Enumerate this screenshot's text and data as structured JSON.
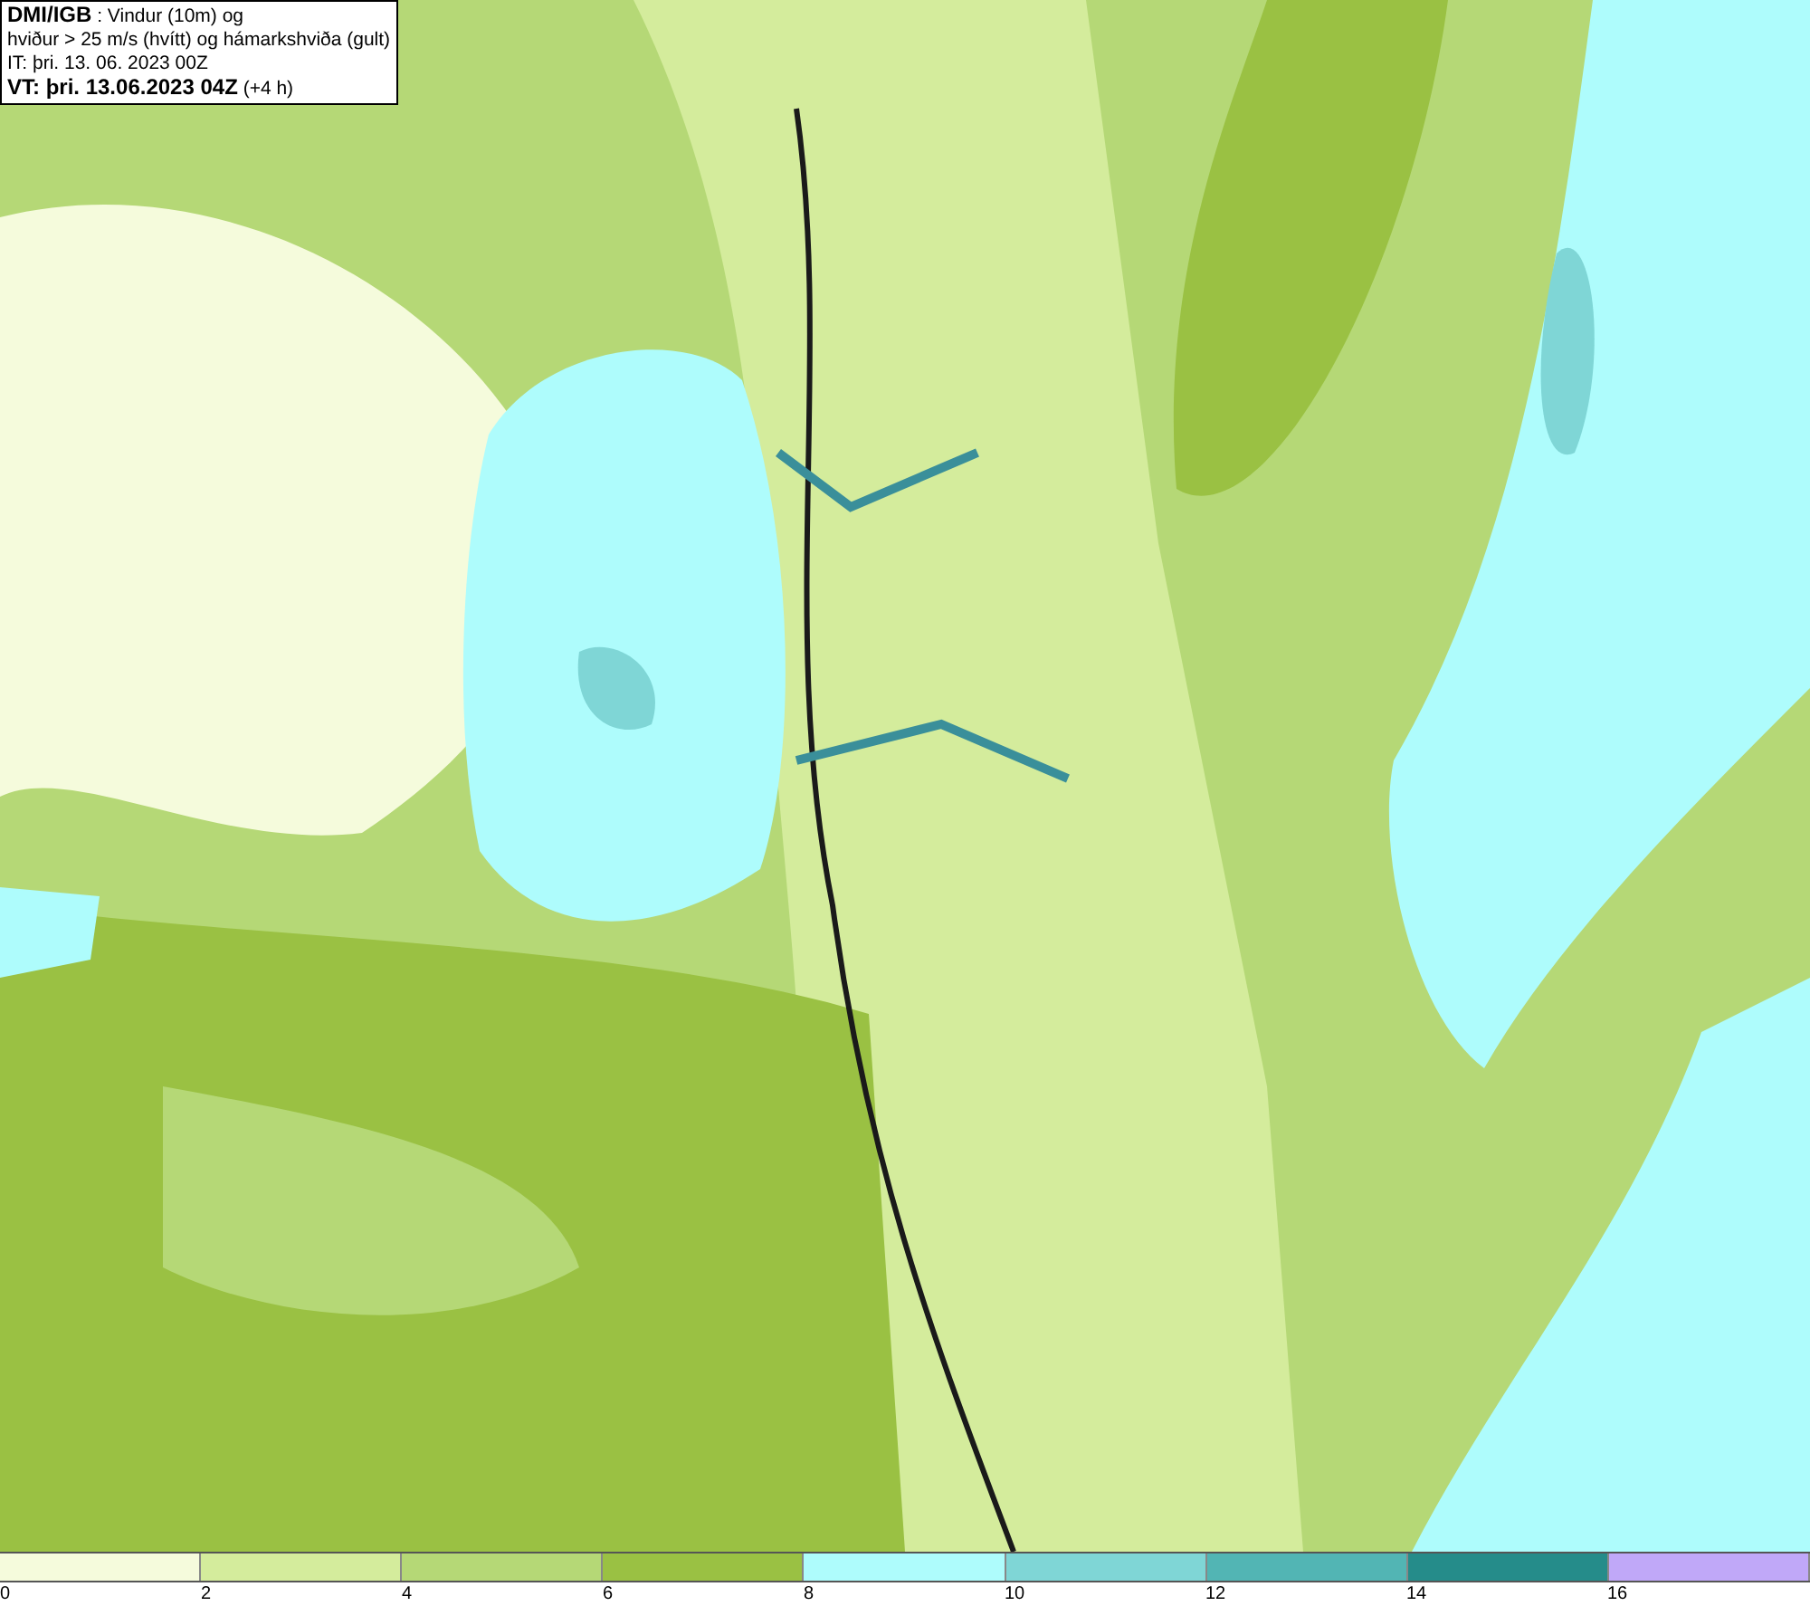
{
  "title_box": {
    "lines": [
      "**DMI/IGB** : Vindur (10m) og",
      "hviður > 25 m/s (hvítt) og hámarkshviða (gult)",
      "IT: þri. 13. 06. 2023 00Z",
      "**VT: þri. 13.06.2023 04Z** (+4 h)"
    ]
  },
  "legend": {
    "bins": [
      {
        "color": "#f5fbdc"
      },
      {
        "color": "#d4ec9c"
      },
      {
        "color": "#b5d876"
      },
      {
        "color": "#9ac143"
      },
      {
        "color": "#aefcfc"
      },
      {
        "color": "#7fd6d6"
      },
      {
        "color": "#52b5b4"
      },
      {
        "color": "#258c8a"
      },
      {
        "color": "#c0a8f8"
      }
    ],
    "ticks": [
      "0",
      "2",
      "4",
      "6",
      "8",
      "10",
      "12",
      "14",
      "16"
    ]
  }
}
